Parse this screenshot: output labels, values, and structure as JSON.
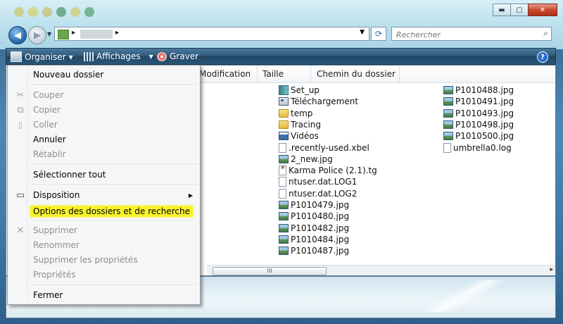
{
  "window": {
    "controls": {
      "minimize": "▬",
      "maximize": "▢",
      "close": "✕"
    }
  },
  "address": {
    "back_glyph": "◀",
    "forward_glyph": "▶",
    "dropdown_glyph": "▼",
    "crumb_arrow": "▸",
    "refresh_glyph": "⟳"
  },
  "search": {
    "placeholder": "Rechercher",
    "icon": "search-icon"
  },
  "toolbar": {
    "organise_label": "Organiser",
    "views_label": "Affichages",
    "burn_label": "Graver",
    "dropdown_glyph": "▾",
    "help_label": "?"
  },
  "columns": {
    "modified": "Modification",
    "size": "Taille",
    "folder_path": "Chemin du dossier"
  },
  "files_col1": [
    {
      "name": "Set_up",
      "icon": "setup"
    },
    {
      "name": "Téléchargement",
      "icon": "app"
    },
    {
      "name": "temp",
      "icon": "folder"
    },
    {
      "name": "Tracing",
      "icon": "folder"
    },
    {
      "name": "Vidéos",
      "icon": "video"
    },
    {
      "name": ".recently-used.xbel",
      "icon": "doc"
    },
    {
      "name": "2_new.jpg",
      "icon": "jpg"
    },
    {
      "name": "Karma Police (2.1).tg",
      "icon": "tg"
    },
    {
      "name": "ntuser.dat.LOG1",
      "icon": "doc"
    },
    {
      "name": "ntuser.dat.LOG2",
      "icon": "doc"
    },
    {
      "name": "P1010479.jpg",
      "icon": "jpg"
    },
    {
      "name": "P1010480.jpg",
      "icon": "jpg"
    },
    {
      "name": "P1010482.jpg",
      "icon": "jpg"
    },
    {
      "name": "P1010484.jpg",
      "icon": "jpg"
    },
    {
      "name": "P1010487.jpg",
      "icon": "jpg"
    }
  ],
  "files_col2": [
    {
      "name": "P1010488.jpg",
      "icon": "jpg"
    },
    {
      "name": "P1010491.jpg",
      "icon": "jpg"
    },
    {
      "name": "P1010493.jpg",
      "icon": "jpg"
    },
    {
      "name": "P1010498.jpg",
      "icon": "jpg"
    },
    {
      "name": "P1010500.jpg",
      "icon": "jpg"
    },
    {
      "name": "umbrella0.log",
      "icon": "doc"
    }
  ],
  "scrollbar": {
    "thumb_grip": "III",
    "right_arrow": "▸"
  },
  "menu": {
    "new_folder": "Nouveau dossier",
    "cut": "Couper",
    "copy": "Copier",
    "paste": "Coller",
    "undo": "Annuler",
    "redo": "Rétablir",
    "select_all": "Sélectionner tout",
    "layout": "Disposition",
    "folder_options": "Options des dossiers et de recherche",
    "delete": "Supprimer",
    "rename": "Renommer",
    "remove_properties": "Supprimer les propriétés",
    "properties": "Propriétés",
    "close": "Fermer",
    "submenu_arrow": "▶",
    "icons": {
      "cut": "✂",
      "copy": "⧉",
      "paste": "📋",
      "delete": "✕",
      "layout": "▭"
    },
    "states": {
      "cut": "disabled",
      "copy": "disabled",
      "paste": "disabled",
      "redo": "disabled",
      "delete": "disabled",
      "rename": "disabled",
      "remove_properties": "disabled",
      "properties": "disabled",
      "folder_options": "highlighted"
    }
  },
  "colors": {
    "highlight": "#f8f32b",
    "toolbar": "#2c5678",
    "disabled_text": "#8f8f8f"
  }
}
